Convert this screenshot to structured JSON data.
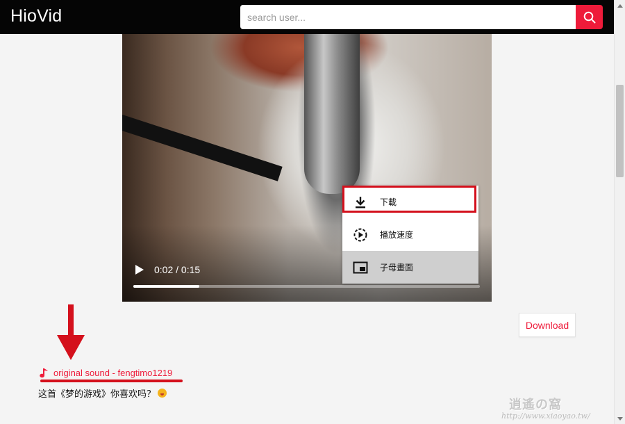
{
  "header": {
    "logo": "HioVid",
    "search": {
      "placeholder": "search user...",
      "value": ""
    },
    "search_button_icon": "search-icon"
  },
  "video": {
    "time_display": "0:02 / 0:15",
    "current_time": "0:02",
    "duration": "0:15",
    "progress_fraction": 0.19
  },
  "context_menu": {
    "items": [
      {
        "label": "下載",
        "icon": "download-icon",
        "highlighted": true
      },
      {
        "label": "播放速度",
        "icon": "playback-speed-icon"
      },
      {
        "label": "子母畫面",
        "icon": "picture-in-picture-icon"
      }
    ]
  },
  "download_button": {
    "label": "Download"
  },
  "sound": {
    "icon": "music-note-icon",
    "label": "original sound - fengtimo1219"
  },
  "caption": {
    "text": "这首《梦的游戏》你喜欢吗？"
  },
  "watermark": {
    "logo": "逍遙の窩",
    "url": "http://www.xiaoyao.tw/"
  },
  "colors": {
    "accent": "#ee1b3a",
    "annotation": "#d4101c",
    "header_bg": "#050505"
  }
}
